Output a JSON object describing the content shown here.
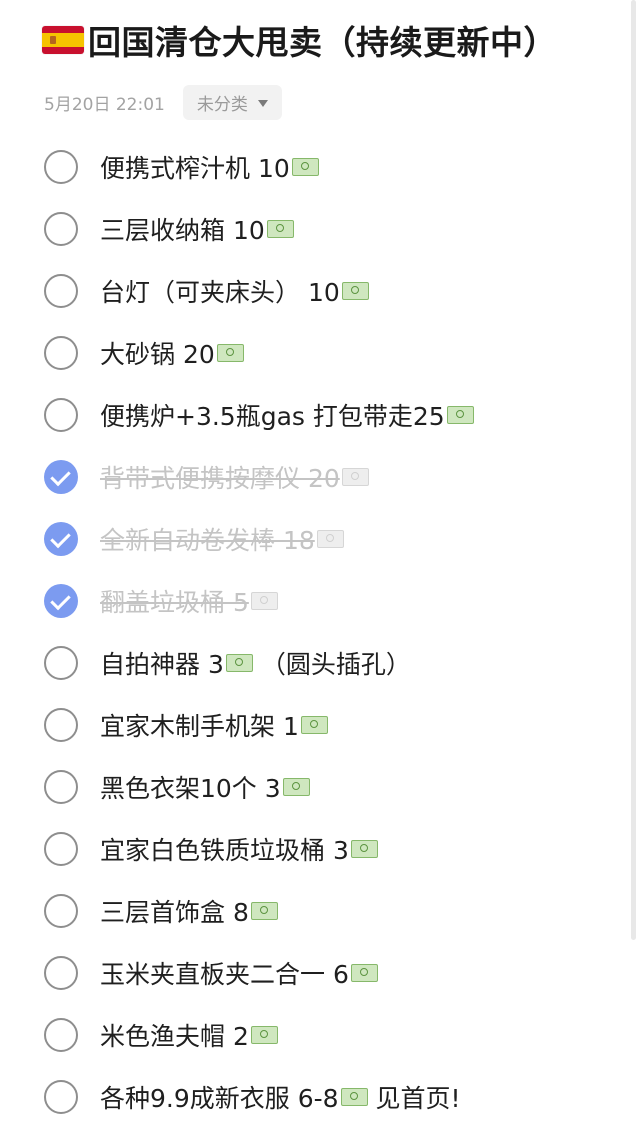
{
  "header": {
    "flag_icon": "spain-flag-icon",
    "title": "回国清仓大甩卖（持续更新中）"
  },
  "meta": {
    "date": "5月20日 22:01",
    "category": "未分类"
  },
  "colors": {
    "checked": "#7c9bf0",
    "unchecked_border": "#8e8e8e",
    "done_text": "#c4c4c4"
  },
  "items": [
    {
      "text": "便携式榨汁机 10",
      "money_icon": true,
      "after": "",
      "checked": false
    },
    {
      "text": "三层收纳箱 10",
      "money_icon": true,
      "after": "",
      "checked": false
    },
    {
      "text": "台灯（可夹床头） 10",
      "money_icon": true,
      "after": "",
      "checked": false
    },
    {
      "text": "大砂锅 20",
      "money_icon": true,
      "after": "",
      "checked": false
    },
    {
      "text": "便携炉+3.5瓶gas 打包带走25",
      "money_icon": true,
      "after": "",
      "checked": false
    },
    {
      "text": "背带式便携按摩仪 20",
      "money_icon": true,
      "after": "",
      "checked": true
    },
    {
      "text": "全新自动卷发棒 18",
      "money_icon": true,
      "after": "",
      "checked": true
    },
    {
      "text": "翻盖垃圾桶 5",
      "money_icon": true,
      "after": "",
      "checked": true
    },
    {
      "text": "自拍神器 3",
      "money_icon": true,
      "after": "（圆头插孔）",
      "checked": false
    },
    {
      "text": "宜家木制手机架 1",
      "money_icon": true,
      "after": "",
      "checked": false
    },
    {
      "text": "黑色衣架10个 3",
      "money_icon": true,
      "after": "",
      "checked": false
    },
    {
      "text": "宜家白色铁质垃圾桶 3",
      "money_icon": true,
      "after": "",
      "checked": false
    },
    {
      "text": "三层首饰盒 8",
      "money_icon": true,
      "after": "",
      "checked": false
    },
    {
      "text": "玉米夹直板夹二合一 6",
      "money_icon": true,
      "after": "",
      "checked": false
    },
    {
      "text": "米色渔夫帽 2",
      "money_icon": true,
      "after": "",
      "checked": false
    },
    {
      "text": "各种9.9成新衣服 6-8",
      "money_icon": true,
      "after": "见首页!",
      "checked": false
    }
  ]
}
